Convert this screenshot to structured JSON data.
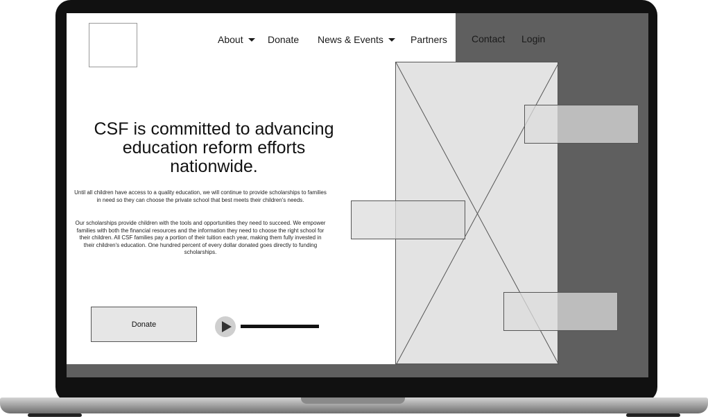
{
  "nav": {
    "items": [
      {
        "label": "About",
        "dropdown": true
      },
      {
        "label": "Donate",
        "dropdown": false
      },
      {
        "label": "News & Events",
        "dropdown": true
      },
      {
        "label": "Partners",
        "dropdown": false
      },
      {
        "label": "Contact",
        "dropdown": false
      },
      {
        "label": "Login",
        "dropdown": false
      }
    ]
  },
  "hero": {
    "headline": "CSF is committed to advancing education reform efforts nationwide.",
    "paragraph1": "Until all children have access to a quality education, we will continue to provide scholarships to families in need so they can choose the private school that best meets their children's needs.",
    "paragraph2": "Our scholarships provide children with the tools and opportunities they need to succeed. We empower families with both the financial resources and the information they need to choose the right school for their children. All CSF families pay a portion of their tuition each year, making them fully invested in their children's education. One hundred percent of every dollar donated goes directly to funding scholarships.",
    "donate_label": "Donate"
  },
  "icons": {
    "caret": "chevron-down-icon",
    "play": "play-icon",
    "image_placeholder": "image-placeholder-icon"
  },
  "colors": {
    "dark_panel": "#5f5f5f",
    "placeholder_fill": "#e3e3e3",
    "laptop_bezel": "#111111"
  }
}
